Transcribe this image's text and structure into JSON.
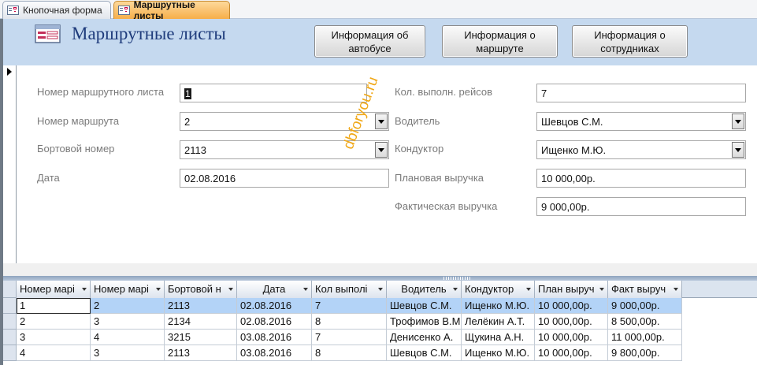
{
  "tabs": [
    {
      "label": "Кнопочная форма",
      "active": false
    },
    {
      "label": "Маршрутные листы",
      "active": true
    }
  ],
  "header": {
    "title": "Маршрутные листы",
    "buttons": [
      {
        "line1": "Информация об",
        "line2": "автобусе"
      },
      {
        "line1": "Информация о",
        "line2": "маршруте"
      },
      {
        "line1": "Информация о",
        "line2": "сотрудниках"
      }
    ]
  },
  "form": {
    "left": [
      {
        "label": "Номер маршрутного листа",
        "value": "1",
        "type": "text"
      },
      {
        "label": "Номер маршрута",
        "value": "2",
        "type": "combo"
      },
      {
        "label": "Бортовой номер",
        "value": "2113",
        "type": "combo"
      },
      {
        "label": "Дата",
        "value": "02.08.2016",
        "type": "text"
      }
    ],
    "right": [
      {
        "label": "Кол. выполн. рейсов",
        "value": "7",
        "type": "text"
      },
      {
        "label": "Водитель",
        "value": "Шевцов С.М.",
        "type": "combo"
      },
      {
        "label": "Кондуктор",
        "value": "Ищенко М.Ю.",
        "type": "combo"
      },
      {
        "label": "Плановая выручка",
        "value": "10 000,00р.",
        "type": "text"
      },
      {
        "label": "Фактическая выручка",
        "value": "9 000,00р.",
        "type": "text"
      }
    ]
  },
  "watermark": "dbforyou.ru",
  "table": {
    "columns": [
      "Номер марі",
      "Номер марі",
      "Бортовой н",
      "Дата",
      "Кол выполі",
      "Водитель",
      "Кондуктор",
      "План выруч",
      "Факт выруч"
    ],
    "rows": [
      [
        "1",
        "2",
        "2113",
        "02.08.2016",
        "7",
        "Шевцов С.М.",
        "Ищенко М.Ю.",
        "10 000,00р.",
        "9 000,00р."
      ],
      [
        "2",
        "3",
        "2134",
        "02.08.2016",
        "8",
        "Трофимов В.М",
        "Лелёкин А.Т.",
        "10 000,00р.",
        "8 500,00р."
      ],
      [
        "3",
        "4",
        "3215",
        "03.08.2016",
        "7",
        "Денисенко А.",
        "Щукина А.Н.",
        "10 000,00р.",
        "11 000,00р."
      ],
      [
        "4",
        "3",
        "2113",
        "03.08.2016",
        "8",
        "Шевцов С.М.",
        "Ищенко М.Ю.",
        "10 000,00р.",
        "9 800,00р."
      ]
    ],
    "selected_row": 0
  },
  "colors": {
    "accent": "#f6ae4a",
    "header_band": "#c5d9ef",
    "title": "#1f3c7c",
    "selection": "#b3d3f7"
  }
}
